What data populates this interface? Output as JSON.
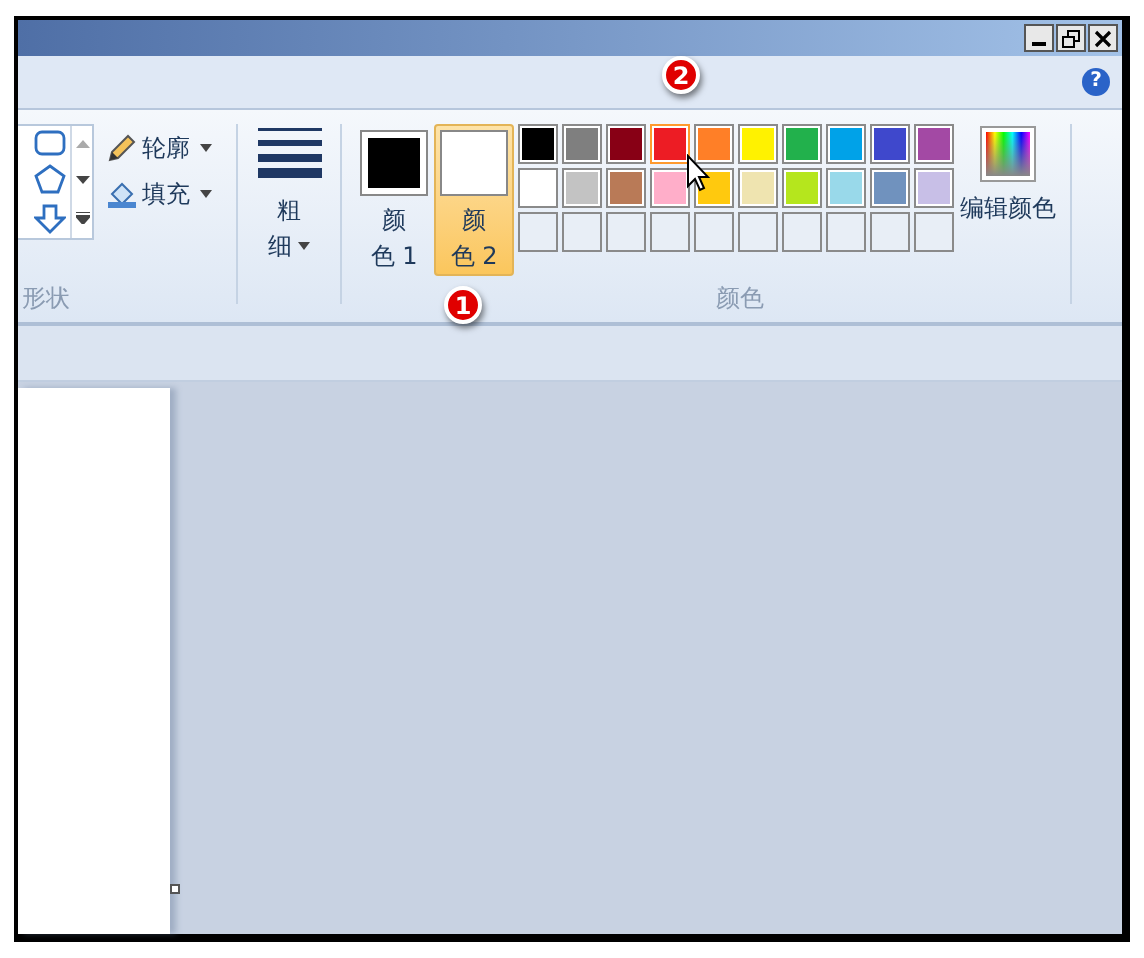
{
  "ribbon": {
    "shapes": {
      "label": "形状"
    },
    "outline": {
      "label": "轮廓"
    },
    "fill": {
      "label": "填充"
    },
    "size": {
      "label_lines": [
        "粗",
        "细"
      ]
    },
    "colors": [
      {
        "label_lines": [
          "颜",
          "色 1"
        ],
        "color": "#000000",
        "selected": false
      },
      {
        "label_lines": [
          "颜",
          "色 2"
        ],
        "color": "#ffffff",
        "selected": true
      }
    ],
    "palette": [
      {
        "kind": "swatch",
        "color": "#000000",
        "selected": false
      },
      {
        "kind": "swatch",
        "color": "#7f7f7f",
        "selected": false
      },
      {
        "kind": "swatch",
        "color": "#880015",
        "selected": false
      },
      {
        "kind": "swatch",
        "color": "#ed1c24",
        "selected": true
      },
      {
        "kind": "swatch",
        "color": "#ff7f27",
        "selected": false
      },
      {
        "kind": "swatch",
        "color": "#fff200",
        "selected": false
      },
      {
        "kind": "swatch",
        "color": "#22b14c",
        "selected": false
      },
      {
        "kind": "swatch",
        "color": "#00a2e8",
        "selected": false
      },
      {
        "kind": "swatch",
        "color": "#3f48cc",
        "selected": false
      },
      {
        "kind": "swatch",
        "color": "#a349a4",
        "selected": false
      },
      {
        "kind": "swatch",
        "color": "#ffffff",
        "selected": false
      },
      {
        "kind": "swatch",
        "color": "#c3c3c3",
        "selected": false
      },
      {
        "kind": "swatch",
        "color": "#b97a57",
        "selected": false
      },
      {
        "kind": "swatch",
        "color": "#ffaec9",
        "selected": false
      },
      {
        "kind": "swatch",
        "color": "#ffc90e",
        "selected": false
      },
      {
        "kind": "swatch",
        "color": "#efe4b0",
        "selected": false
      },
      {
        "kind": "swatch",
        "color": "#b5e61d",
        "selected": false
      },
      {
        "kind": "swatch",
        "color": "#99d9ea",
        "selected": false
      },
      {
        "kind": "swatch",
        "color": "#7092be",
        "selected": false
      },
      {
        "kind": "swatch",
        "color": "#c8bfe7",
        "selected": false
      },
      {
        "kind": "empty"
      },
      {
        "kind": "empty"
      },
      {
        "kind": "empty"
      },
      {
        "kind": "empty"
      },
      {
        "kind": "empty"
      },
      {
        "kind": "empty"
      },
      {
        "kind": "empty"
      },
      {
        "kind": "empty"
      },
      {
        "kind": "empty"
      },
      {
        "kind": "empty"
      }
    ],
    "edit_colors": {
      "label": "编辑颜色"
    },
    "colors_group_label": "颜色"
  },
  "help_button": "?",
  "callouts": [
    {
      "number": "1"
    },
    {
      "number": "2"
    }
  ]
}
